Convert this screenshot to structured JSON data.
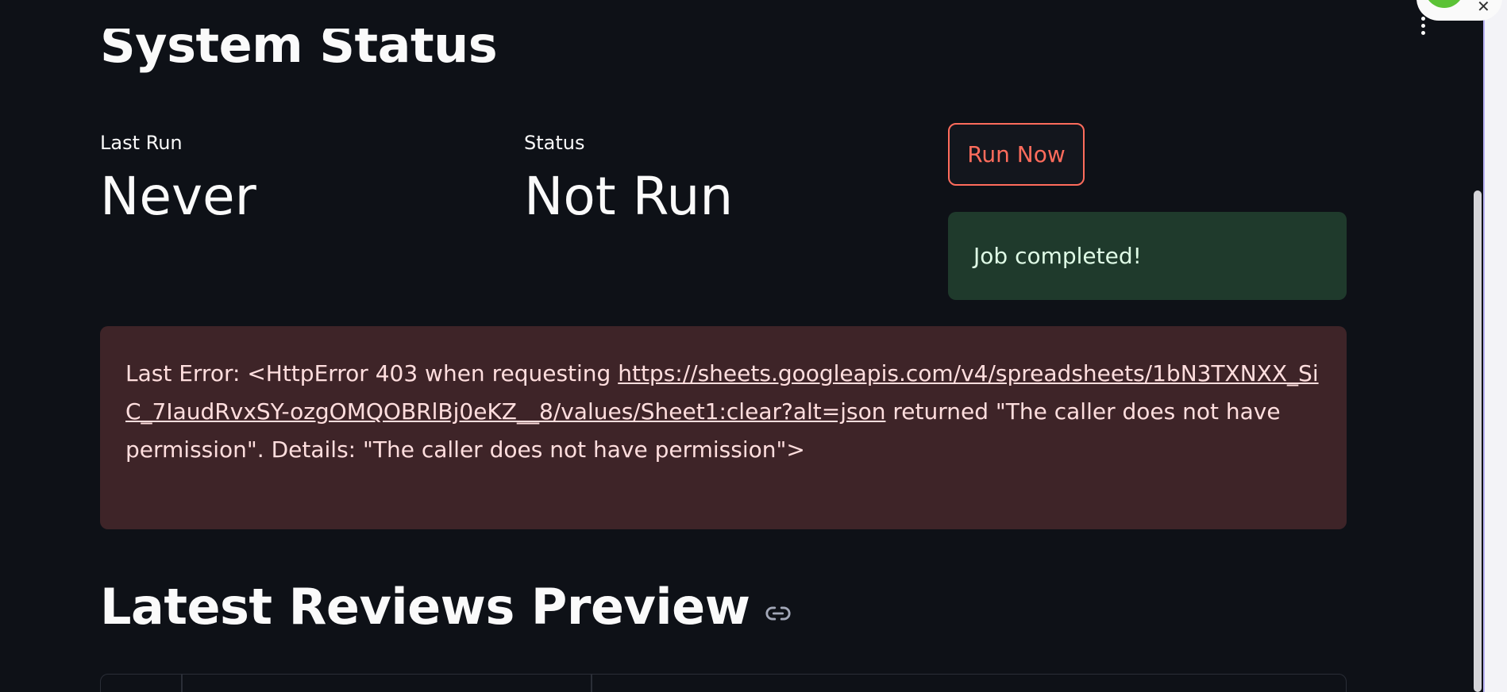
{
  "page": {
    "section_title_top": "System Status",
    "section_title_bottom": "Latest Reviews Preview"
  },
  "metrics": [
    {
      "label": "Last Run",
      "value": "Never"
    },
    {
      "label": "Status",
      "value": "Not Run"
    }
  ],
  "actions": {
    "run_now_label": "Run Now"
  },
  "alerts": {
    "success_text": "Job completed!",
    "error_prefix": "Last Error: <HttpError 403 when requesting ",
    "error_link": "https://sheets.googleapis.com/v4/spreadsheets/1bN3TXNXX_SiC_7IaudRvxSY-ozgOMQOBRlBj0eKZ__8/values/Sheet1:clear?alt=json",
    "error_suffix": " returned \"The caller does not have permission\". Details: \"The caller does not have permission\">"
  },
  "colors": {
    "background": "#0e1117",
    "accent": "#ff6c5c",
    "success_bg": "#1f3a2c",
    "error_bg": "#3e2428"
  },
  "icons": {
    "anchor": "link-icon",
    "menu": "more-vertical-icon"
  }
}
